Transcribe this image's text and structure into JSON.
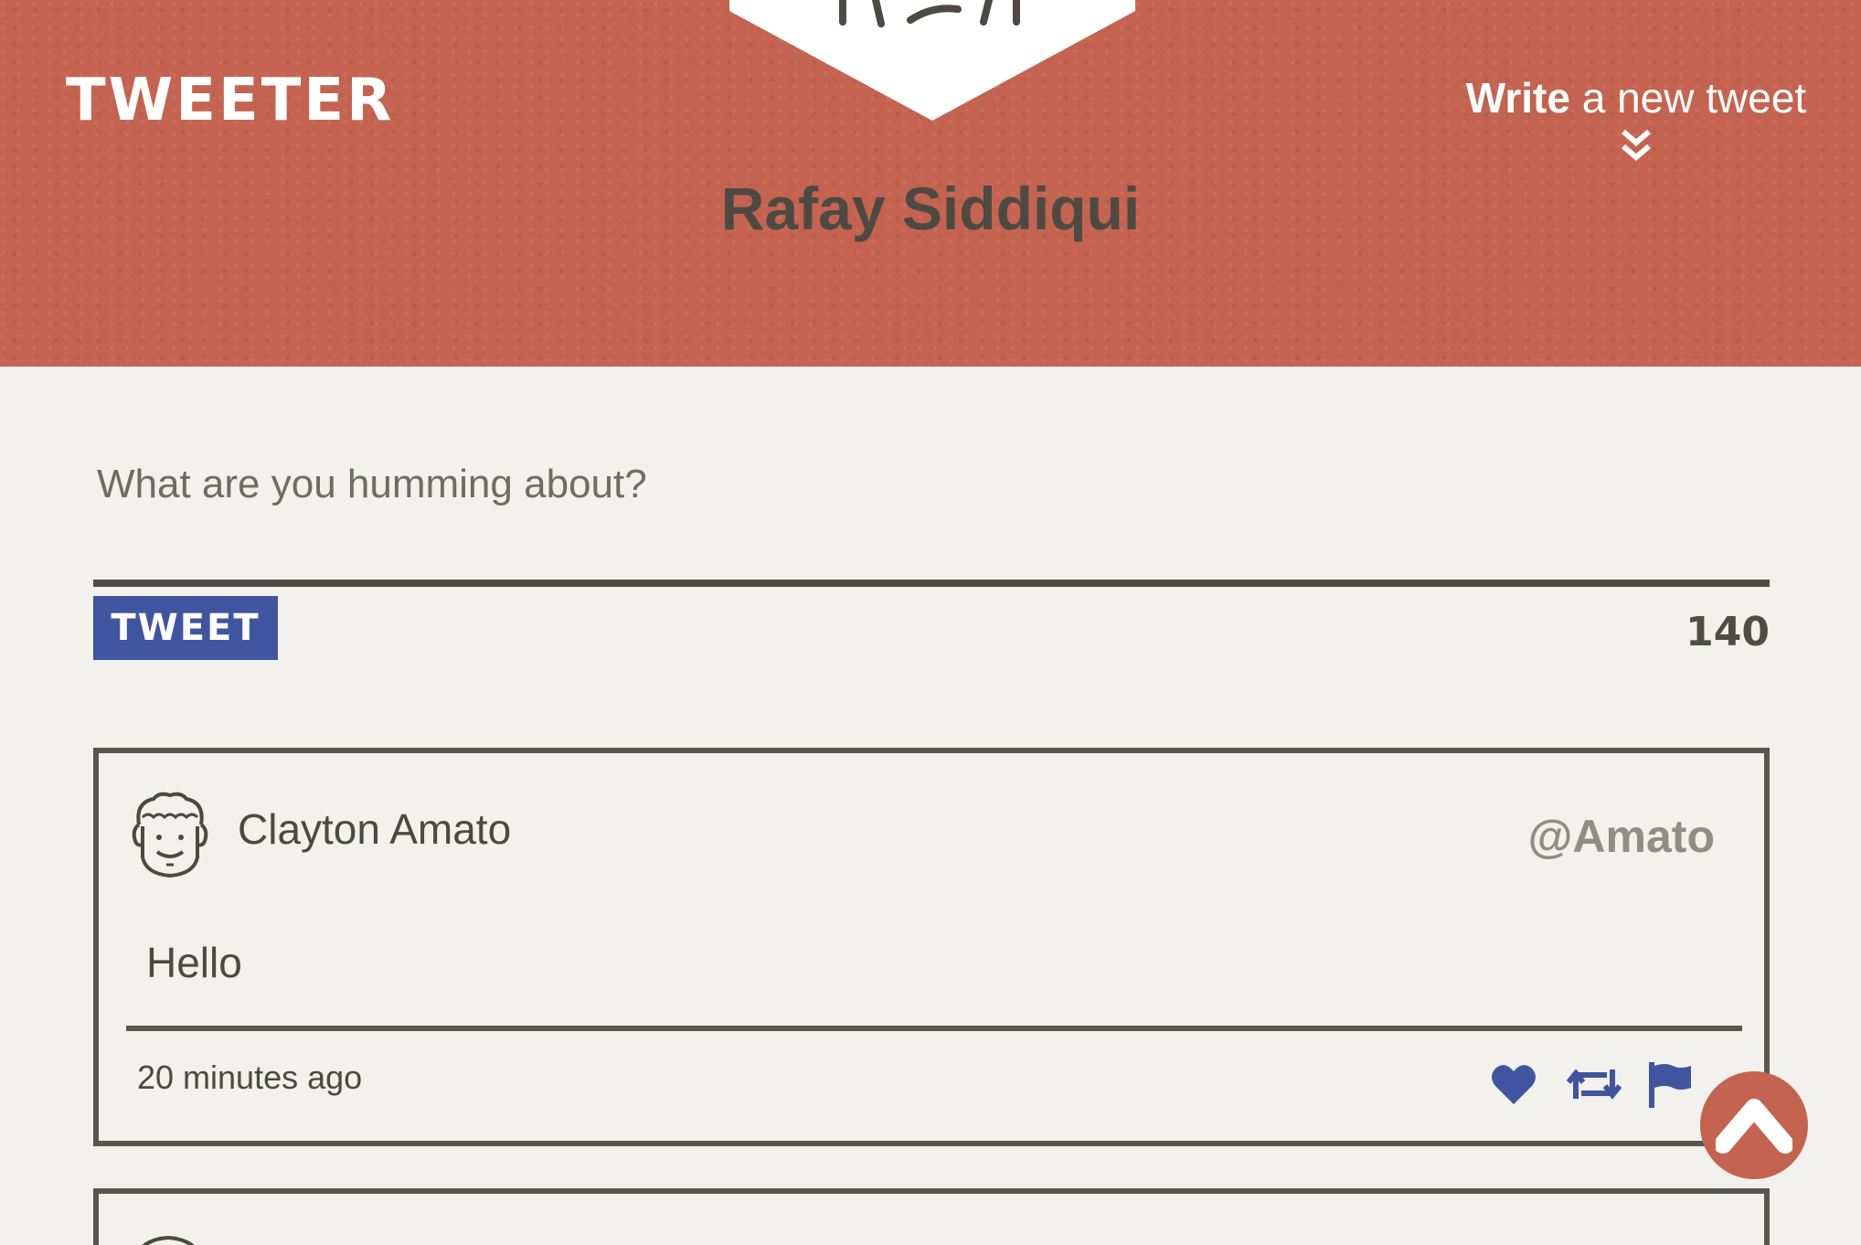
{
  "header": {
    "logo_text": "TWEETER",
    "profile_name": "Rafay Siddiqui",
    "compose_toggle": {
      "bold_word": "Write",
      "rest": " a new tweet",
      "icon": "double-chevron-down-icon"
    },
    "avatar_icon": "bird-face-icon"
  },
  "composer": {
    "placeholder": "What are you humming about?",
    "value": "",
    "submit_label": "TWEET",
    "counter": "140"
  },
  "tweets": [
    {
      "author": "Clayton Amato",
      "handle": "@Amato",
      "avatar_icon": "curly-hair-face-icon",
      "body": "Hello",
      "time": "20 minutes ago",
      "actions": [
        "heart-icon",
        "retweet-icon",
        "flag-icon"
      ]
    }
  ],
  "colors": {
    "header_bg": "#c4634f",
    "page_bg": "#f2f1ed",
    "accent_blue": "#4055a0",
    "border": "#575752"
  },
  "scroll_top_icon": "chevron-up-icon"
}
